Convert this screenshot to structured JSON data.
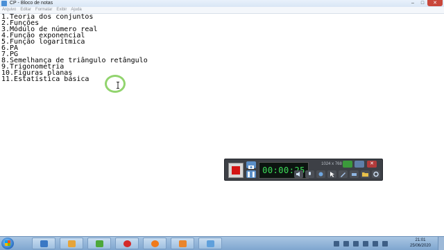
{
  "window": {
    "title": "CP - Bloco de notas",
    "controls": {
      "minimize": "–",
      "maximize": "□",
      "close": "✕"
    }
  },
  "menu": {
    "items": [
      "Arquivo",
      "Editar",
      "Formatar",
      "Exibir",
      "Ajuda"
    ]
  },
  "editor": {
    "lines": [
      "1.Teoria dos conjuntos",
      "2.Funções",
      "3.Módulo de número real",
      "4.Função exponencial",
      "5.Função logarítmica",
      "6.PA",
      "7.PG",
      "8.Semelhança de triângulo retângulo",
      "9.Trigonometria",
      "10.Figuras planas",
      "11.Estatística básica"
    ]
  },
  "recorder": {
    "timer": "00:00:25",
    "resolution": "1024 x 768",
    "pause_icon": "❚❚",
    "close_icon": "✕",
    "colors": {
      "stop": "#d41414",
      "timer_text": "#3ee05a"
    }
  },
  "taskbar": {
    "apps": [
      "windows-explorer",
      "photos",
      "utorrent",
      "opera",
      "firefox",
      "media-player",
      "notepad"
    ],
    "clock": {
      "time": "21:01",
      "date": "25/06/2020"
    }
  }
}
